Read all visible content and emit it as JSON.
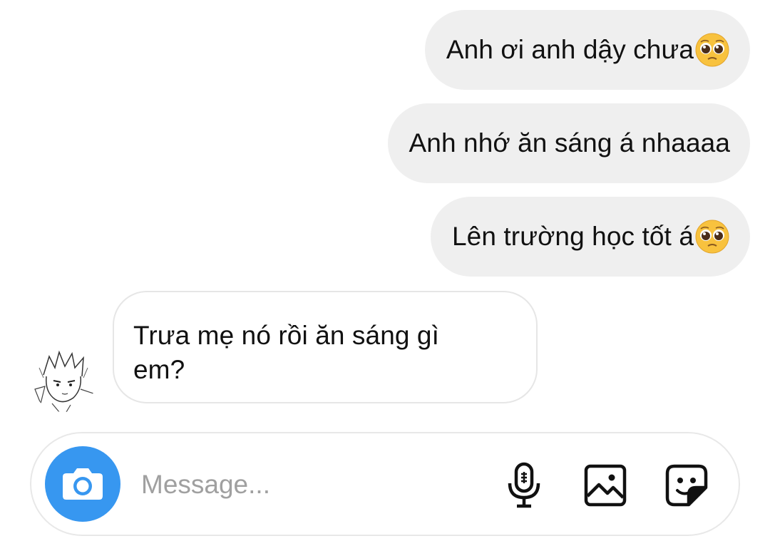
{
  "conversation": {
    "messages": [
      {
        "sender": "me",
        "text": "Anh ơi anh dậy chưa",
        "emoji": "pleading-face"
      },
      {
        "sender": "me",
        "text": "Anh nhớ ăn sáng á nhaaaa",
        "emoji": null
      },
      {
        "sender": "me",
        "text": "Lên trường học tốt á",
        "emoji": "pleading-face"
      },
      {
        "sender": "other",
        "line1": "Trưa mẹ nó rồi ăn sáng gì",
        "line2": "em?"
      }
    ]
  },
  "composer": {
    "placeholder": "Message...",
    "icons": [
      "camera-icon",
      "microphone-icon",
      "gallery-icon",
      "sticker-icon"
    ]
  },
  "colors": {
    "accent": "#3797f0",
    "sent_bubble": "#efefef",
    "received_border": "#e6e6e6",
    "placeholder": "#a0a0a0"
  }
}
